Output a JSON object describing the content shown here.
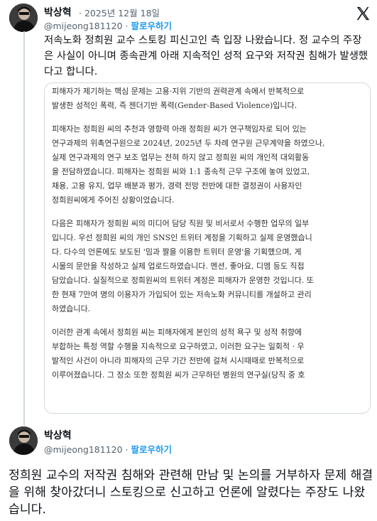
{
  "post1": {
    "author": "박상혁",
    "date": "· 2025년 12월 18일",
    "handle": "@mijeong181120 ·",
    "follow": "팔로우하기",
    "text": "저속노화 정희원 교수 스토킹 피신고인 측 입장 나왔습니다. 정 교수의 주장은 사실이 아니며 종속관계 아래 지속적인 성적 요구와 저작권 침해가 발생했다고 합니다."
  },
  "document": {
    "paragraphs": [
      [
        "피해자가 제기하는 핵심 문제는 고용·지위 기반의 권력관계 속에서 반복적으로",
        "발생한 성적인 폭력, 즉 젠더기반 폭력(Gender-Based Violence)입니다."
      ],
      [
        "피해자는 정희원 씨의 추천과 영향력 아래 정희원 씨가 연구책임자로 되어 있는",
        "연구과제의 위촉연구원으로 2024년, 2025년 두 차례 연구원 근무계약을 하였으나,",
        "실제 연구과제의 연구 보조 업무는 전혀 하지 않고 정희원 씨의 개인적 대외활동",
        "을 전담하였습니다. 피해자는 정희원 씨와 1:1 종속적 근무 구조에 놓여 있었고,",
        "채용, 고용 유지, 업무 배분과 평가, 경력 전망 전반에 대한 결정권이 사용자인",
        "정희원씨에게 주어진 상황이었습니다."
      ],
      [
        "다음은 피해자가 정희원 씨의 미디어 담당 직원 및 비서로서 수행한 업무의 일부",
        "입니다. 우선 정희원 씨의 개인 SNS인 트위터 계정을 기획하고 실제 운영했습니",
        "다. 다수의 언론에도 보도된 '밈과 짤을 이용한 트위터 운영'을 기획했으며, 게",
        "시물의 문안을 작성하고 실제 업로드하였습니다. 멘션, 좋아요, 디엠 등도 직접",
        "담았습니다. 실질적으로 정희원씨의 트위터 계정은 피해자가 운영한 것입니다. 또",
        "한 현재 7만여 명의 이용자가 가입되어 있는 저속노화 커뮤니티를 개설하고 관리",
        "하였습니다."
      ],
      [
        "이러한 관계 속에서 정희원 씨는 피해자에게 본인의 성적 욕구 및 성적 취향에",
        "부합하는 특정 역할 수행을 지속적으로 요구하였고, 이러한 요구는 일회적 · 우",
        "발적인 사건이 아니라 피해자의 근무 기간 전반에 걸쳐 시시때때로 반복적으로",
        "이루어졌습니다. 그 장소 또한 정희원 씨가 근무하던 병원의 연구실(당직 중 호"
      ]
    ]
  },
  "post2": {
    "author": "박상혁",
    "handle": "@mijeong181120 ·",
    "follow": "팔로우하기",
    "text": "정희원 교수의 저작권 침해와 관련해 만남 및 논의를 거부하자 문제 해결을 위해 찾아갔더니 스토킹으로 신고하고 언론에 알렸다는 주장도 나왔습니다."
  },
  "icons": {
    "platform_logo": "x-logo-icon"
  }
}
